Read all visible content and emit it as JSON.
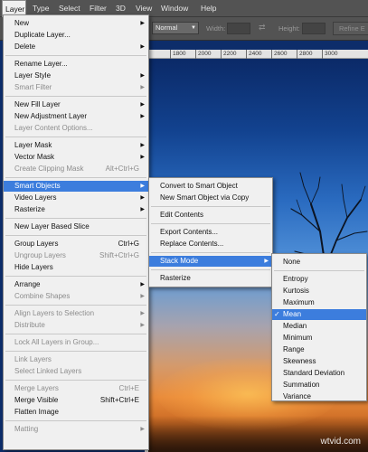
{
  "menubar": [
    "Layer",
    "Type",
    "Select",
    "Filter",
    "3D",
    "View",
    "Window",
    "Help"
  ],
  "options": {
    "blend_mode": "Normal",
    "width_label": "Width:",
    "height_label": "Height:",
    "refine_label": "Refine E"
  },
  "ruler": [
    "1800",
    "2000",
    "2200",
    "2400",
    "2600",
    "2800",
    "3000"
  ],
  "layer_menu": [
    {
      "label": "New",
      "shortcut": "",
      "sub": true,
      "disabled": false
    },
    {
      "label": "Duplicate Layer...",
      "shortcut": "",
      "sub": false,
      "disabled": false
    },
    {
      "label": "Delete",
      "shortcut": "",
      "sub": true,
      "disabled": false
    },
    {
      "label": "Rename Layer...",
      "shortcut": "",
      "sub": false,
      "disabled": false
    },
    {
      "label": "Layer Style",
      "shortcut": "",
      "sub": true,
      "disabled": false
    },
    {
      "label": "Smart Filter",
      "shortcut": "",
      "sub": true,
      "disabled": true
    },
    {
      "label": "New Fill Layer",
      "shortcut": "",
      "sub": true,
      "disabled": false
    },
    {
      "label": "New Adjustment Layer",
      "shortcut": "",
      "sub": true,
      "disabled": false
    },
    {
      "label": "Layer Content Options...",
      "shortcut": "",
      "sub": false,
      "disabled": true
    },
    {
      "label": "Layer Mask",
      "shortcut": "",
      "sub": true,
      "disabled": false
    },
    {
      "label": "Vector Mask",
      "shortcut": "",
      "sub": true,
      "disabled": false
    },
    {
      "label": "Create Clipping Mask",
      "shortcut": "Alt+Ctrl+G",
      "sub": false,
      "disabled": true
    },
    {
      "label": "Smart Objects",
      "shortcut": "",
      "sub": true,
      "disabled": false
    },
    {
      "label": "Video Layers",
      "shortcut": "",
      "sub": true,
      "disabled": false
    },
    {
      "label": "Rasterize",
      "shortcut": "",
      "sub": true,
      "disabled": false
    },
    {
      "label": "New Layer Based Slice",
      "shortcut": "",
      "sub": false,
      "disabled": false
    },
    {
      "label": "Group Layers",
      "shortcut": "Ctrl+G",
      "sub": false,
      "disabled": false
    },
    {
      "label": "Ungroup Layers",
      "shortcut": "Shift+Ctrl+G",
      "sub": false,
      "disabled": true
    },
    {
      "label": "Hide Layers",
      "shortcut": "",
      "sub": false,
      "disabled": false
    },
    {
      "label": "Arrange",
      "shortcut": "",
      "sub": true,
      "disabled": false
    },
    {
      "label": "Combine Shapes",
      "shortcut": "",
      "sub": true,
      "disabled": true
    },
    {
      "label": "Align Layers to Selection",
      "shortcut": "",
      "sub": true,
      "disabled": true
    },
    {
      "label": "Distribute",
      "shortcut": "",
      "sub": true,
      "disabled": true
    },
    {
      "label": "Lock All Layers in Group...",
      "shortcut": "",
      "sub": false,
      "disabled": true
    },
    {
      "label": "Link Layers",
      "shortcut": "",
      "sub": false,
      "disabled": true
    },
    {
      "label": "Select Linked Layers",
      "shortcut": "",
      "sub": false,
      "disabled": true
    },
    {
      "label": "Merge Layers",
      "shortcut": "Ctrl+E",
      "sub": false,
      "disabled": true
    },
    {
      "label": "Merge Visible",
      "shortcut": "Shift+Ctrl+E",
      "sub": false,
      "disabled": false
    },
    {
      "label": "Flatten Image",
      "shortcut": "",
      "sub": false,
      "disabled": false
    },
    {
      "label": "Matting",
      "shortcut": "",
      "sub": true,
      "disabled": true
    }
  ],
  "smart_objects_menu": [
    {
      "label": "Convert to Smart Object",
      "sub": false
    },
    {
      "label": "New Smart Object via Copy",
      "sub": false
    },
    {
      "label": "Edit Contents",
      "sub": false
    },
    {
      "label": "Export Contents...",
      "sub": false
    },
    {
      "label": "Replace Contents...",
      "sub": false
    },
    {
      "label": "Stack Mode",
      "sub": true
    },
    {
      "label": "Rasterize",
      "sub": false
    }
  ],
  "stack_mode_menu": [
    {
      "label": "None",
      "checked": false
    },
    {
      "label": "Entropy",
      "checked": false
    },
    {
      "label": "Kurtosis",
      "checked": false
    },
    {
      "label": "Maximum",
      "checked": false
    },
    {
      "label": "Mean",
      "checked": true
    },
    {
      "label": "Median",
      "checked": false
    },
    {
      "label": "Minimum",
      "checked": false
    },
    {
      "label": "Range",
      "checked": false
    },
    {
      "label": "Skewness",
      "checked": false
    },
    {
      "label": "Standard Deviation",
      "checked": false
    },
    {
      "label": "Summation",
      "checked": false
    },
    {
      "label": "Variance",
      "checked": false
    }
  ],
  "watermark": "wtvid.com"
}
